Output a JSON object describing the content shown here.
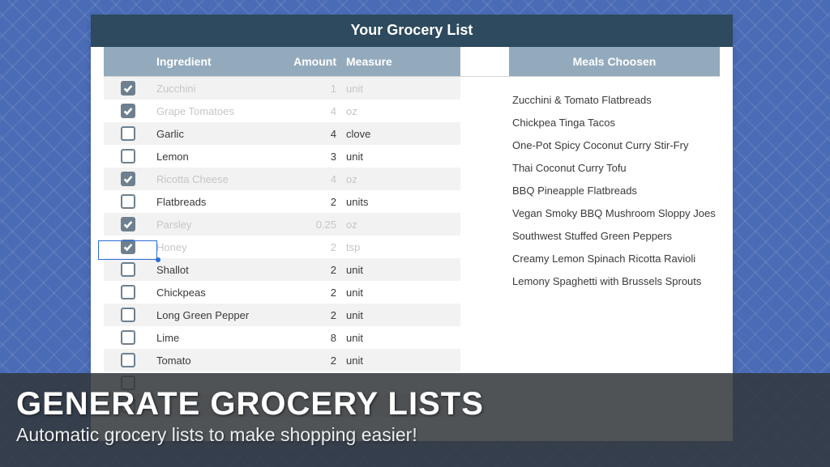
{
  "title": "Your Grocery List",
  "columns": {
    "ingredient": "Ingredient",
    "amount": "Amount",
    "measure": "Measure",
    "meals": "Meals Choosen"
  },
  "ingredients": [
    {
      "name": "Zucchini",
      "amount": "1",
      "measure": "unit",
      "checked": true
    },
    {
      "name": "Grape Tomatoes",
      "amount": "4",
      "measure": "oz",
      "checked": true
    },
    {
      "name": "Garlic",
      "amount": "4",
      "measure": "clove",
      "checked": false
    },
    {
      "name": "Lemon",
      "amount": "3",
      "measure": "unit",
      "checked": false
    },
    {
      "name": "Ricotta Cheese",
      "amount": "4",
      "measure": "oz",
      "checked": true
    },
    {
      "name": "Flatbreads",
      "amount": "2",
      "measure": "units",
      "checked": false
    },
    {
      "name": "Parsley",
      "amount": "0.25",
      "measure": "oz",
      "checked": true
    },
    {
      "name": "Honey",
      "amount": "2",
      "measure": "tsp",
      "checked": true
    },
    {
      "name": "Shallot",
      "amount": "2",
      "measure": "unit",
      "checked": false
    },
    {
      "name": "Chickpeas",
      "amount": "2",
      "measure": "unit",
      "checked": false
    },
    {
      "name": "Long Green Pepper",
      "amount": "2",
      "measure": "unit",
      "checked": false
    },
    {
      "name": "Lime",
      "amount": "8",
      "measure": "unit",
      "checked": false
    },
    {
      "name": "Tomato",
      "amount": "2",
      "measure": "unit",
      "checked": false
    },
    {
      "name": "",
      "amount": "",
      "measure": "",
      "checked": false
    },
    {
      "name": "",
      "amount": "",
      "measure": "",
      "checked": false
    }
  ],
  "meals": [
    "Zucchini & Tomato Flatbreads",
    "Chickpea Tinga Tacos",
    "One-Pot Spicy Coconut Curry Stir-Fry",
    "Thai Coconut Curry Tofu",
    "BBQ Pineapple Flatbreads",
    "Vegan Smoky BBQ Mushroom Sloppy Joes",
    "Southwest Stuffed Green Peppers",
    "Creamy Lemon Spinach Ricotta Ravioli",
    "Lemony Spaghetti with Brussels Sprouts"
  ],
  "banner": {
    "headline": "GENERATE GROCERY LISTS",
    "sub": "Automatic grocery lists to make shopping easier!"
  }
}
